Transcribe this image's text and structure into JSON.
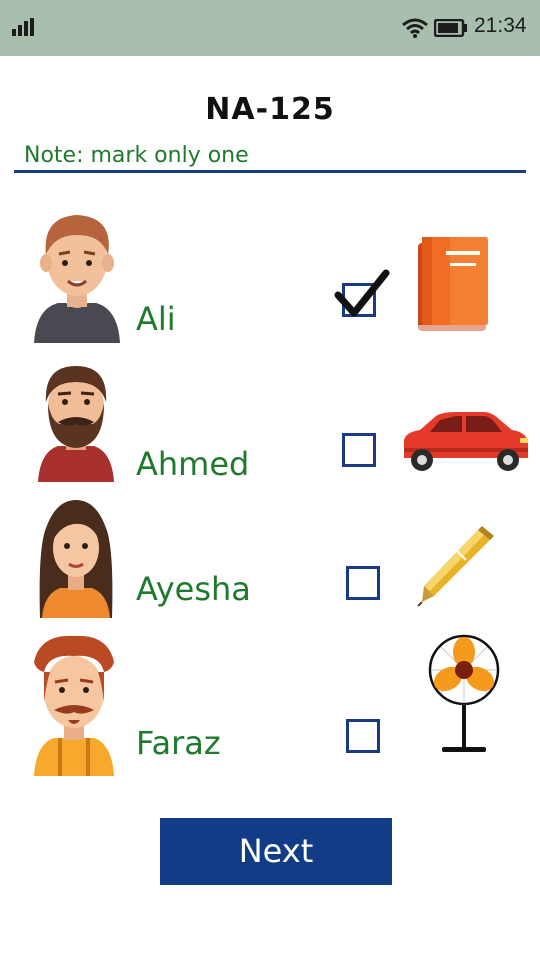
{
  "status_bar": {
    "time": "21:34"
  },
  "page": {
    "title": "NA-125",
    "note": "Note: mark only one"
  },
  "candidates": [
    {
      "name": "Ali",
      "checked": true,
      "symbol": "book-icon"
    },
    {
      "name": "Ahmed",
      "checked": false,
      "symbol": "car-icon"
    },
    {
      "name": "Ayesha",
      "checked": false,
      "symbol": "pen-icon"
    },
    {
      "name": "Faraz",
      "checked": false,
      "symbol": "fan-icon"
    }
  ],
  "next_button": {
    "label": "Next"
  },
  "colors": {
    "status_bar": "#a9bfae",
    "accent_green": "#1f7a2e",
    "navy": "#123d86"
  }
}
